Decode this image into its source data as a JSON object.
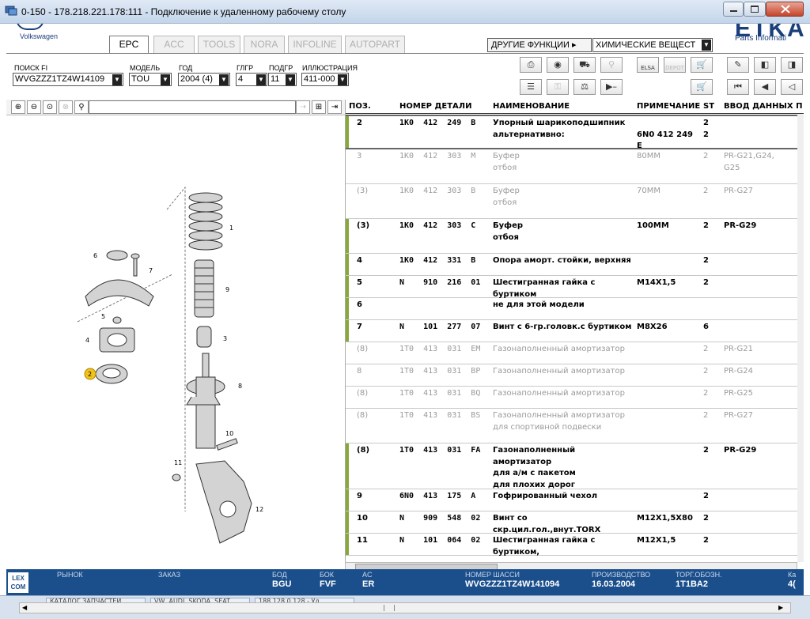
{
  "window": {
    "title": "0-150 - 178.218.221.178:111 - Подключение к удаленному рабочему столу"
  },
  "brand": {
    "vw_name": "Volkswagen",
    "etka_text": "ETKA",
    "etka_subtitle": "Parts Informati"
  },
  "tabs": [
    {
      "label": "EPC",
      "active": true
    },
    {
      "label": "ACC",
      "active": false
    },
    {
      "label": "TOOLS",
      "active": false
    },
    {
      "label": "NORA",
      "active": false
    },
    {
      "label": "INFOLINE",
      "active": false
    },
    {
      "label": "AUTOPART",
      "active": false
    }
  ],
  "functions": {
    "other_label": "ДРУГИЕ ФУНКЦИИ ▸",
    "chem_value": "ХИМИЧЕСКИЕ ВЕЩЕСТ"
  },
  "filters": {
    "search_label": "ПОИСК FI",
    "search_value": "WVGZZZ1TZ4W14109",
    "model_label": "МОДЕЛЬ",
    "model_value": "TOU",
    "year_label": "ГОД",
    "year_value": "2004 (4)",
    "group_label": "ГЛГР",
    "group_value": "4",
    "subgroup_label": "ПОДГР",
    "subgroup_value": "11",
    "illus_label": "ИЛЛЮСТРАЦИЯ",
    "illus_value": "411-000"
  },
  "toolbar_icons": [
    "printer-icon",
    "disc-icon",
    "car-icon",
    "search-parts-icon",
    "elsa-icon",
    "dealer-icon",
    "cart-add-icon",
    "pin-icon",
    "prev-page-icon",
    "next-page-icon",
    "list-icon",
    "key-icon",
    "scale-icon",
    "play-icon",
    "cart-icon",
    "first-page-icon",
    "prev-icon",
    "back-icon"
  ],
  "toolbar_labels": {
    "elsa": "ELSA",
    "dealer": "DEPOT"
  },
  "columns": {
    "pos": "ПОЗ.",
    "part": "НОМЕР ДЕТАЛИ",
    "name": "НАИМЕНОВАНИЕ",
    "note": "ПРИМЕЧАНИЕ",
    "st": "ST",
    "input": "ВВОД ДАННЫХ П"
  },
  "parts": [
    {
      "pos": "2",
      "part": "1K0  412  249  B",
      "name": "Упорный шарикоподшипник\n      альтернативно:",
      "note": "\n6N0 412 249 E",
      "st": "2\n2",
      "data": "",
      "dim": false,
      "bar": false
    },
    {
      "pos": "3",
      "part": "1K0  412  303  M",
      "name": "Буфер\nотбоя",
      "note": "80MM",
      "st": "2",
      "data": "PR-G21,G24,\nG25",
      "dim": true,
      "bar": false
    },
    {
      "pos": "(3)",
      "part": "1K0  412  303  B",
      "name": "Буфер\nотбоя",
      "note": "70MM",
      "st": "2",
      "data": "PR-G27",
      "dim": true,
      "bar": false
    },
    {
      "pos": "(3)",
      "part": "1K0  412  303  C",
      "name": "Буфер\nотбоя",
      "note": "100MM",
      "st": "2",
      "data": "PR-G29",
      "dim": false,
      "bar": true
    },
    {
      "pos": "4",
      "part": "1K0  412  331  B",
      "name": "Опора аморт. стойки, верхняя",
      "note": "",
      "st": "2",
      "data": "",
      "dim": false,
      "bar": true
    },
    {
      "pos": "5",
      "part": "N    910  216  01",
      "name": "Шестигранная гайка с буртиком",
      "note": "M14X1,5",
      "st": "2",
      "data": "",
      "dim": false,
      "bar": true
    },
    {
      "pos": "6",
      "part": "",
      "name": "не для этой модели",
      "note": "",
      "st": "",
      "data": "",
      "dim": false,
      "bar": true
    },
    {
      "pos": "7",
      "part": "N    101  277  07",
      "name": "Винт с 6-гр.головк.с буртиком",
      "note": "M8X26",
      "st": "6",
      "data": "",
      "dim": false,
      "bar": true
    },
    {
      "pos": "(8)",
      "part": "1T0  413  031  EM",
      "name": "Газонаполненный амортизатор",
      "note": "",
      "st": "2",
      "data": "PR-G21",
      "dim": true,
      "bar": false
    },
    {
      "pos": "8",
      "part": "1T0  413  031  BP",
      "name": "Газонаполненный амортизатор",
      "note": "",
      "st": "2",
      "data": "PR-G24",
      "dim": true,
      "bar": false
    },
    {
      "pos": "(8)",
      "part": "1T0  413  031  BQ",
      "name": "Газонаполненный амортизатор",
      "note": "",
      "st": "2",
      "data": "PR-G25",
      "dim": true,
      "bar": false
    },
    {
      "pos": "(8)",
      "part": "1T0  413  031  BS",
      "name": "Газонаполненный амортизатор\nдля спортивной подвески",
      "note": "",
      "st": "2",
      "data": "PR-G27",
      "dim": true,
      "bar": false
    },
    {
      "pos": "(8)",
      "part": "1T0  413  031  FA",
      "name": "Газонаполненный амортизатор\nдля а/м с пакетом\nдля плохих дорог",
      "note": "",
      "st": "2",
      "data": "PR-G29",
      "dim": false,
      "bar": true
    },
    {
      "pos": "9",
      "part": "6N0  413  175  A",
      "name": "Гофрированный чехол",
      "note": "",
      "st": "2",
      "data": "",
      "dim": false,
      "bar": true
    },
    {
      "pos": "10",
      "part": "N    909  548  02",
      "name": "Винт со скр.цил.гол.,внут.TORX",
      "note": "M12X1,5X80",
      "st": "2",
      "data": "",
      "dim": false,
      "bar": true
    },
    {
      "pos": "11",
      "part": "N    101  064  02",
      "name": "Шестигранная гайка с буртиком,",
      "note": "M12X1,5",
      "st": "2",
      "data": "",
      "dim": false,
      "bar": true
    }
  ],
  "illustration": {
    "labels": [
      "1",
      "2",
      "3",
      "4",
      "5",
      "6",
      "7",
      "8",
      "9",
      "10",
      "11",
      "12"
    ]
  },
  "status": {
    "lexcom": "LEX\nCOM",
    "market_label": "РЫНОК",
    "order_label": "ЗАКАЗ",
    "bod_label": "БОД",
    "bod_value": "BGU",
    "bok_label": "БОК",
    "bok_value": "FVF",
    "ac_label": "AC",
    "ac_value": "ER",
    "chassis_label": "НОМЕР ШАССИ",
    "chassis_value": "WVGZZZ1TZ4W141094",
    "prod_label": "ПРОИЗВОДСТВО",
    "prod_value": "16.03.2004",
    "trade_label": "ТОРГ.ОБОЗН.",
    "trade_value": "1T1BA2",
    "k_label": "Ка",
    "k_value": "4("
  },
  "taskbar": [
    "КАТАЛОГ ЗАПЧАСТЕЙ",
    "VW, AUDI, SKODA, SEAT",
    "188.128.0.128 - Уд"
  ]
}
